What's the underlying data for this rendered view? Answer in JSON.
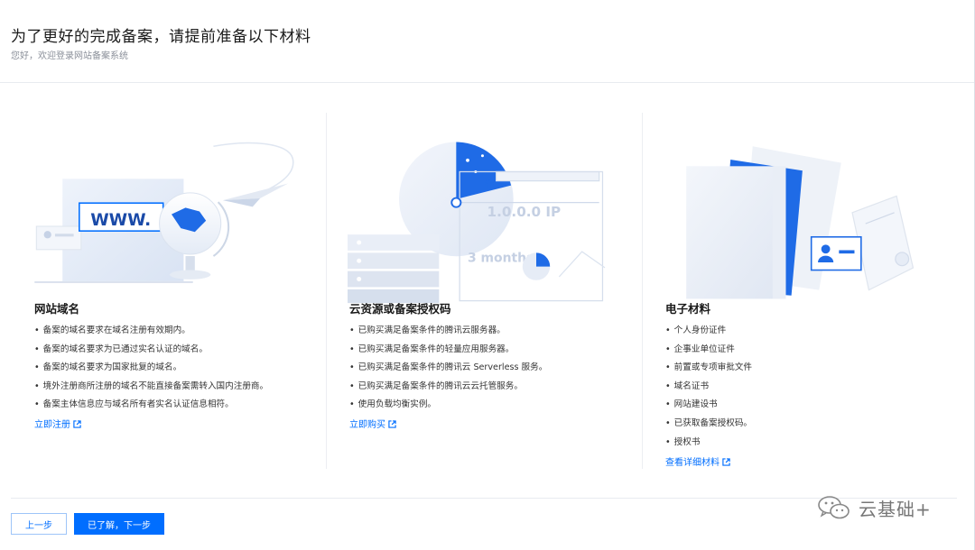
{
  "header": {
    "title": "为了更好的完成备案，请提前准备以下材料",
    "subtitle": "您好，欢迎登录网站备案系统"
  },
  "columns": [
    {
      "title": "网站域名",
      "items": [
        "备案的域名要求在域名注册有效期内。",
        "备案的域名要求为已通过实名认证的域名。",
        "备案的域名要求为国家批复的域名。",
        "境外注册商所注册的域名不能直接备案需转入国内注册商。",
        "备案主体信息应与域名所有者实名认证信息相符。"
      ],
      "link": "立即注册",
      "illustration": {
        "www_text": "WWW."
      }
    },
    {
      "title": "云资源或备案授权码",
      "items": [
        "已购买满足备案条件的腾讯云服务器。",
        "已购买满足备案条件的轻量应用服务器。",
        "已购买满足备案条件的腾讯云 Serverless 服务。",
        "已购买满足备案条件的腾讯云云托管服务。",
        "使用负载均衡实例。"
      ],
      "link": "立即购买",
      "illustration": {
        "currency": "¥",
        "ip_text": "1.0.0.0 IP",
        "months_text": "3 months"
      }
    },
    {
      "title": "电子材料",
      "items": [
        "个人身份证件",
        "企事业单位证件",
        "前置或专项审批文件",
        "域名证书",
        "网站建设书",
        "已获取备案授权码。",
        "授权书"
      ],
      "link": "查看详细材料"
    }
  ],
  "footer": {
    "prev_label": "上一步",
    "next_label": "已了解，下一步"
  },
  "watermark": {
    "text": "云基础+",
    "icon": "wechat-icon"
  },
  "colors": {
    "primary": "#006eff",
    "border": "#e8ebf0",
    "text": "#333333"
  }
}
